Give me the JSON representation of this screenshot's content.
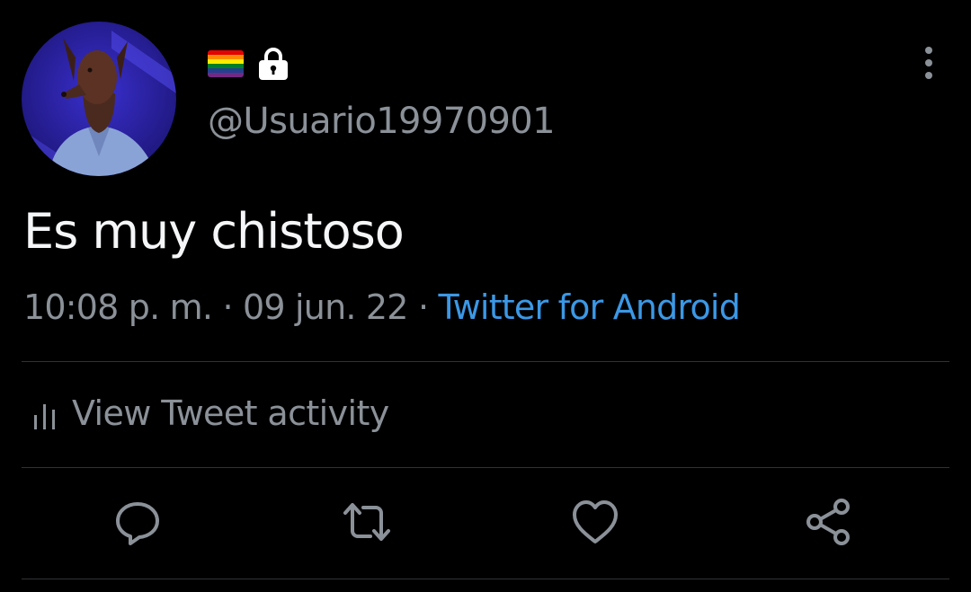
{
  "tweet": {
    "handle": "@Usuario19970901",
    "text": "Es muy chistoso",
    "time": "10:08 p. m.",
    "date": "09 jun. 22",
    "separator": "·",
    "source": "Twitter for Android"
  },
  "activity": {
    "label": "View Tweet activity",
    "icon": "bar-chart-icon"
  },
  "actions": [
    {
      "icon": "reply-icon"
    },
    {
      "icon": "retweet-icon"
    },
    {
      "icon": "like-icon"
    },
    {
      "icon": "share-icon"
    }
  ],
  "header_icons": [
    "rainbow-flag-icon",
    "lock-icon",
    "more-options-icon"
  ],
  "colors": {
    "background": "#000000",
    "text": "#f5f6f7",
    "secondary": "#8b9198",
    "link": "#3b98e6",
    "divider": "#2f3336"
  }
}
